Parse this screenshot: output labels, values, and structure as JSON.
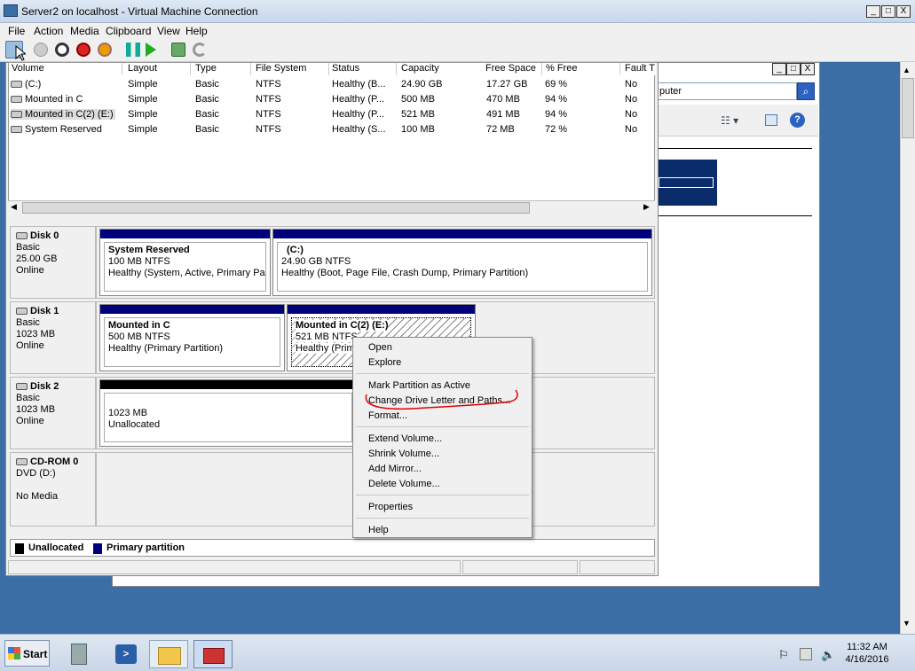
{
  "vm": {
    "title": "Server2 on localhost - Virtual Machine Connection",
    "menu": [
      "File",
      "Action",
      "Media",
      "Clipboard",
      "View",
      "Help"
    ],
    "win_min": "_",
    "win_max": "□",
    "win_close": "X"
  },
  "background_window": {
    "search_value": "puter",
    "search_icon": "magnifier-icon"
  },
  "volume_list": {
    "columns": [
      "Volume",
      "Layout",
      "Type",
      "File System",
      "Status",
      "Capacity",
      "Free Space",
      "% Free",
      "Fault T"
    ],
    "rows": [
      {
        "volume": "(C:)",
        "layout": "Simple",
        "type": "Basic",
        "fs": "NTFS",
        "status": "Healthy (B...",
        "capacity": "24.90 GB",
        "free": "17.27 GB",
        "pct": "69 %",
        "fault": "No"
      },
      {
        "volume": "Mounted in C",
        "layout": "Simple",
        "type": "Basic",
        "fs": "NTFS",
        "status": "Healthy (P...",
        "capacity": "500 MB",
        "free": "470 MB",
        "pct": "94 %",
        "fault": "No"
      },
      {
        "volume": "Mounted in C(2) (E:)",
        "layout": "Simple",
        "type": "Basic",
        "fs": "NTFS",
        "status": "Healthy (P...",
        "capacity": "521 MB",
        "free": "491 MB",
        "pct": "94 %",
        "fault": "No"
      },
      {
        "volume": "System Reserved",
        "layout": "Simple",
        "type": "Basic",
        "fs": "NTFS",
        "status": "Healthy (S...",
        "capacity": "100 MB",
        "free": "72 MB",
        "pct": "72 %",
        "fault": "No"
      }
    ]
  },
  "disks": [
    {
      "name": "Disk 0",
      "type": "Basic",
      "size": "25.00 GB",
      "state": "Online",
      "partitions": [
        {
          "title": "System Reserved",
          "size": "100 MB NTFS",
          "status": "Healthy (System, Active, Primary Part"
        },
        {
          "title": "(C:)",
          "size": "24.90 GB NTFS",
          "status": "Healthy (Boot, Page File, Crash Dump, Primary Partition)"
        }
      ]
    },
    {
      "name": "Disk 1",
      "type": "Basic",
      "size": "1023 MB",
      "state": "Online",
      "partitions": [
        {
          "title": "Mounted in C",
          "size": "500 MB NTFS",
          "status": "Healthy (Primary Partition)"
        },
        {
          "title": "Mounted in C(2)  (E:)",
          "size": "521 MB NTFS",
          "status": "Healthy (Prima"
        }
      ]
    },
    {
      "name": "Disk 2",
      "type": "Basic",
      "size": "1023 MB",
      "state": "Online",
      "partitions": [
        {
          "title": "",
          "size": "1023 MB",
          "status": "Unallocated"
        }
      ]
    },
    {
      "name": "CD-ROM 0",
      "type": "DVD (D:)",
      "size": "",
      "state": "No Media",
      "partitions": []
    }
  ],
  "legend": {
    "unallocated": "Unallocated",
    "primary": "Primary partition",
    "unallocated_color": "#000000",
    "primary_color": "#00007a"
  },
  "context_menu": {
    "items": [
      "Open",
      "Explore",
      "Mark Partition as Active",
      "Change Drive Letter and Paths...",
      "Format...",
      "Extend Volume...",
      "Shrink Volume...",
      "Add Mirror...",
      "Delete Volume...",
      "Properties",
      "Help"
    ],
    "highlight_color": "#e00000"
  },
  "taskbar": {
    "start": "Start",
    "time": "11:32 AM",
    "date": "4/16/2016"
  }
}
